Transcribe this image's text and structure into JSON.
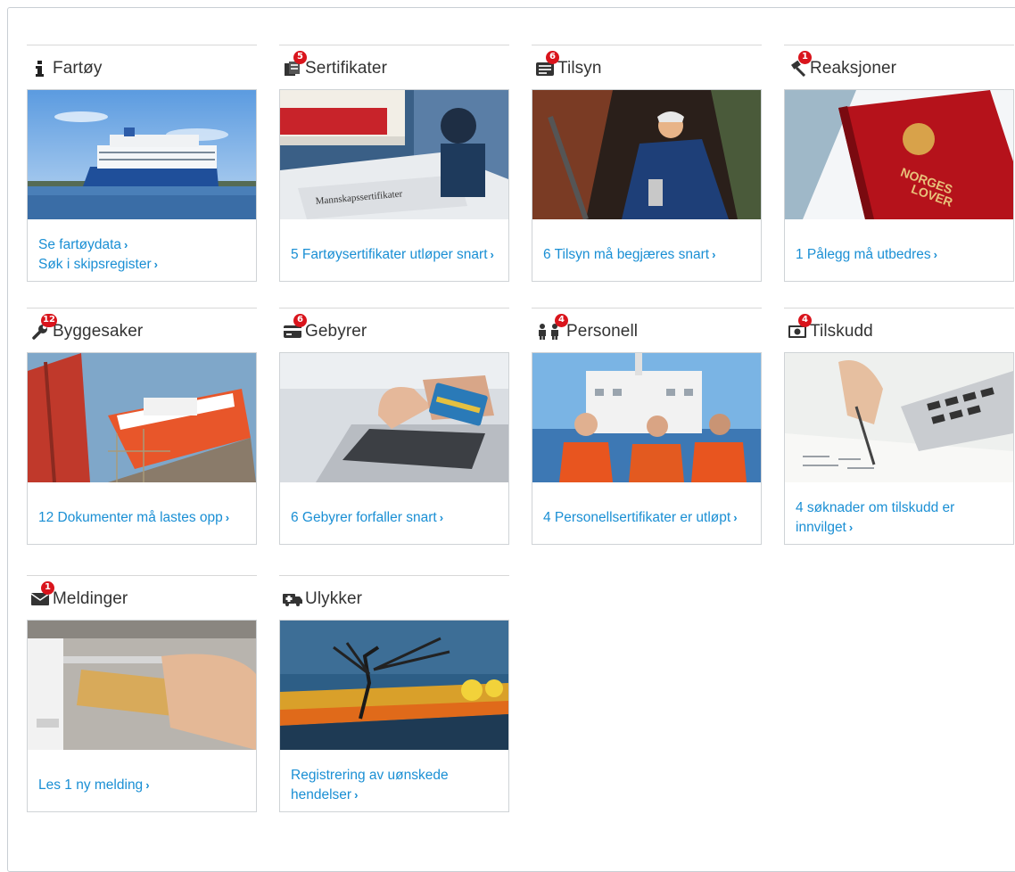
{
  "colors": {
    "link": "#1a8fd4",
    "badge": "#d9141c",
    "title": "#333333",
    "border": "#cfd3d6"
  },
  "tiles": [
    {
      "title": "Fartøy",
      "icon": "info-icon",
      "badge": "",
      "links": [
        {
          "text": "Se fartøydata"
        },
        {
          "text": "Søk i skipsregister"
        }
      ]
    },
    {
      "title": "Sertifikater",
      "icon": "certificate-icon",
      "badge": "5",
      "links": [
        {
          "text": "5 Fartøysertifikater utløper snart"
        }
      ]
    },
    {
      "title": "Tilsyn",
      "icon": "inspection-icon",
      "badge": "6",
      "links": [
        {
          "text": "6 Tilsyn må begjæres snart"
        }
      ]
    },
    {
      "title": "Reaksjoner",
      "icon": "gavel-icon",
      "badge": "1",
      "links": [
        {
          "text": "1 Pålegg må utbedres"
        }
      ]
    },
    {
      "title": "Byggesaker",
      "icon": "wrench-icon",
      "badge": "12",
      "links": [
        {
          "text": "12 Dokumenter må lastes opp"
        }
      ]
    },
    {
      "title": "Gebyrer",
      "icon": "credit-card-icon",
      "badge": "6",
      "links": [
        {
          "text": "6 Gebyrer forfaller snart"
        }
      ]
    },
    {
      "title": "Personell",
      "icon": "people-icon",
      "badge": "4",
      "links": [
        {
          "text": "4 Personellsertifikater er utløpt"
        }
      ]
    },
    {
      "title": "Tilskudd",
      "icon": "money-icon",
      "badge": "4",
      "links": [
        {
          "text": "4 søknader om tilskudd er innvilget"
        }
      ]
    },
    {
      "title": "Meldinger",
      "icon": "envelope-icon",
      "badge": "1",
      "links": [
        {
          "text": "Les 1 ny melding"
        }
      ]
    },
    {
      "title": "Ulykker",
      "icon": "ambulance-icon",
      "badge": "",
      "links": [
        {
          "text": "Registrering av uønskede hendelser"
        }
      ]
    }
  ]
}
